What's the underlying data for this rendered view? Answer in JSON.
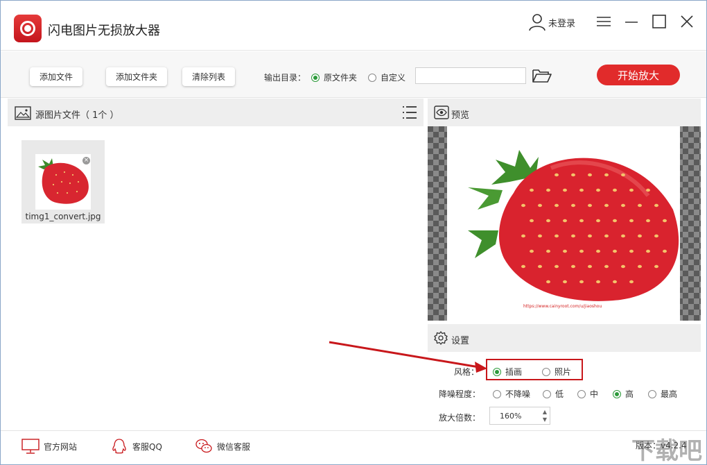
{
  "app": {
    "title": "闪电图片无损放大器"
  },
  "user": {
    "login_label": "未登录"
  },
  "toolbar": {
    "add_file": "添加文件",
    "add_folder": "添加文件夹",
    "clear_list": "清除列表",
    "output_label": "输出目录：",
    "radio_original": "原文件夹",
    "radio_custom": "自定义",
    "output_selected": "原文件夹",
    "path_value": "",
    "start_button": "开始放大"
  },
  "source": {
    "title": "源图片文件（ 1个 ）",
    "files": [
      {
        "name": "timg1_convert.jpg"
      }
    ]
  },
  "preview": {
    "title": "预览",
    "image_caption": "https://www.cainyroot.com/u/jiaoshou"
  },
  "settings": {
    "title": "设置",
    "style_label": "风格：",
    "style_options": [
      "插画",
      "照片"
    ],
    "style_selected": "插画",
    "noise_label": "降噪程度：",
    "noise_options": [
      "不降噪",
      "低",
      "中",
      "高",
      "最高"
    ],
    "noise_selected": "高",
    "scale_label": "放大倍数：",
    "scale_value": "160%"
  },
  "footer": {
    "website": "官方网站",
    "qq_service": "客服QQ",
    "wechat_service": "微信客服",
    "version": "版本：v4.2.4"
  },
  "watermark": {
    "text": "下载吧"
  },
  "icons": {
    "logo": "magnifier-logo-icon",
    "user": "user-icon",
    "menu": "hamburger-menu-icon",
    "minimize": "minimize-icon",
    "maximize": "maximize-icon",
    "close": "close-icon",
    "folder": "folder-open-icon",
    "image": "image-icon",
    "list": "list-icon",
    "eye": "eye-icon",
    "gear": "gear-icon",
    "monitor": "monitor-icon",
    "qq": "qq-icon",
    "wechat": "wechat-icon"
  },
  "colors": {
    "accent": "#e12b2b",
    "radio_on": "#2c9a3a",
    "highlight": "#c8171b"
  }
}
